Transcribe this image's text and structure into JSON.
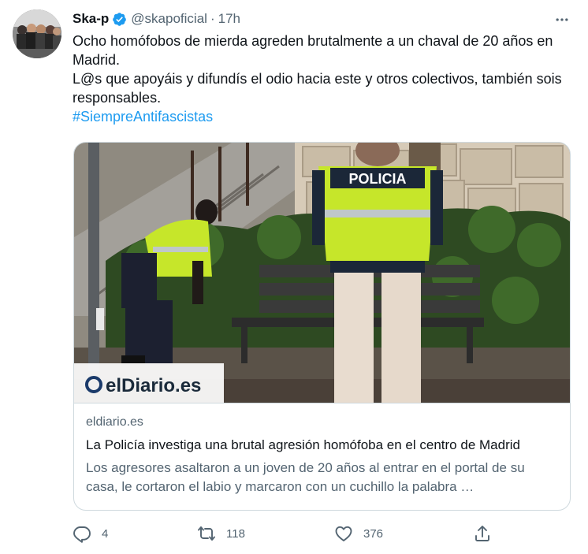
{
  "author": {
    "name": "Ska-p",
    "handle": "@skapoficial",
    "separator": "·",
    "time": "17h",
    "verified": true
  },
  "icons": {
    "verified": "verified-badge-icon",
    "more": "more-horizontal-icon",
    "reply": "reply-icon",
    "retweet": "retweet-icon",
    "like": "heart-icon",
    "share": "share-icon"
  },
  "tweet": {
    "line1": "Ocho homófobos de mierda agreden brutalmente a un chaval de 20 años en Madrid.",
    "line2": "L@s que apoyáis y difundís el odio hacia este y otros colectivos, también sois responsables.",
    "hashtag": "#SiempreAntifascistas"
  },
  "card": {
    "image_logo": "elDiario.es",
    "image_vest_text": "POLICIA",
    "domain": "eldiario.es",
    "title": "La Policía investiga una brutal agresión homófoba en el centro de Madrid",
    "description": "Los agresores asaltaron a un joven de 20 años al entrar en el portal de su casa, le cortaron el labio y marcaron con un cuchillo la palabra …"
  },
  "actions": {
    "replies": "4",
    "retweets": "118",
    "likes": "376"
  },
  "colors": {
    "accent": "#1d9bf0",
    "text": "#0f1419",
    "secondary": "#536471",
    "border": "#cfd9de",
    "vest": "#c6e62a"
  }
}
